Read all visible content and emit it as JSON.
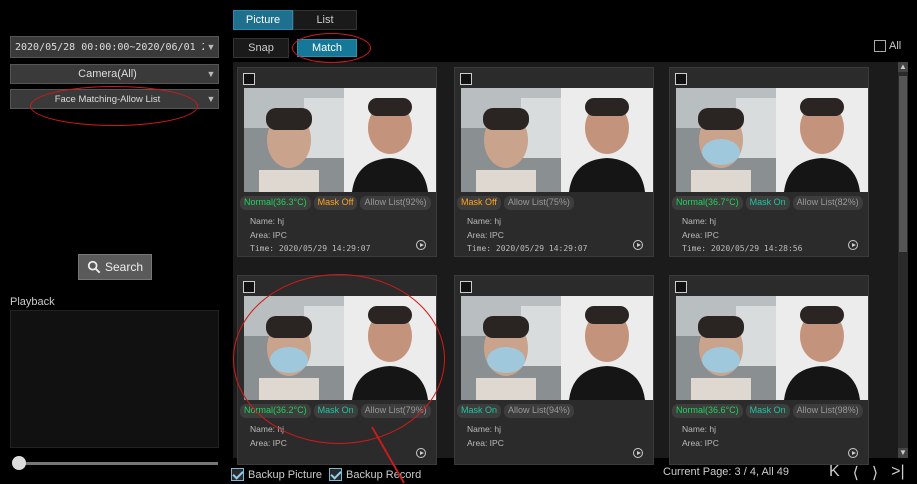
{
  "left": {
    "date_range": "2020/05/28 00:00:00~2020/06/01 23:...",
    "camera": "Camera(All)",
    "match_type": "Face Matching-Allow List",
    "search_label": "Search",
    "playback_label": "Playback"
  },
  "tabs": {
    "picture": "Picture",
    "list": "List"
  },
  "subtabs": {
    "snap": "Snap",
    "match": "Match"
  },
  "all_label": "All",
  "cards": [
    {
      "tags": [
        {
          "t": "Normal(36.3°C)",
          "c": "green"
        },
        {
          "t": "Mask Off",
          "c": "orange"
        },
        {
          "t": "Allow List(92%)",
          "c": "gray"
        }
      ],
      "name": "Name:  hj",
      "area": "Area:  IPC",
      "time": "Time:  2020/05/29 14:29:07"
    },
    {
      "tags": [
        {
          "t": "Mask Off",
          "c": "orange"
        },
        {
          "t": "Allow List(75%)",
          "c": "gray"
        }
      ],
      "name": "Name:  hj",
      "area": "Area:  IPC",
      "time": "Time:  2020/05/29 14:29:07"
    },
    {
      "tags": [
        {
          "t": "Normal(36.7°C)",
          "c": "green"
        },
        {
          "t": "Mask On",
          "c": "teal"
        },
        {
          "t": "Allow List(82%)",
          "c": "gray"
        }
      ],
      "name": "Name:  hj",
      "area": "Area:  IPC",
      "time": "Time:  2020/05/29 14:28:56"
    },
    {
      "tags": [
        {
          "t": "Normal(36.2°C)",
          "c": "green"
        },
        {
          "t": "Mask On",
          "c": "teal"
        },
        {
          "t": "Allow List(79%)",
          "c": "gray"
        }
      ],
      "name": "Name:  hj",
      "area": "Area:  IPC",
      "time": ""
    },
    {
      "tags": [
        {
          "t": "Mask On",
          "c": "teal"
        },
        {
          "t": "Allow List(94%)",
          "c": "gray"
        }
      ],
      "name": "Name:  hj",
      "area": "Area:  IPC",
      "time": ""
    },
    {
      "tags": [
        {
          "t": "Normal(36.6°C)",
          "c": "green"
        },
        {
          "t": "Mask On",
          "c": "teal"
        },
        {
          "t": "Allow List(98%)",
          "c": "gray"
        }
      ],
      "name": "Name:  hj",
      "area": "Area:  IPC",
      "time": ""
    }
  ],
  "footer": {
    "backup_picture": "Backup Picture",
    "backup_record": "Backup Record",
    "page_info": "Current Page: 3 / 4, All 49"
  },
  "colors": {
    "accent": "#1f6f8e",
    "annotation": "#d21a1a"
  }
}
